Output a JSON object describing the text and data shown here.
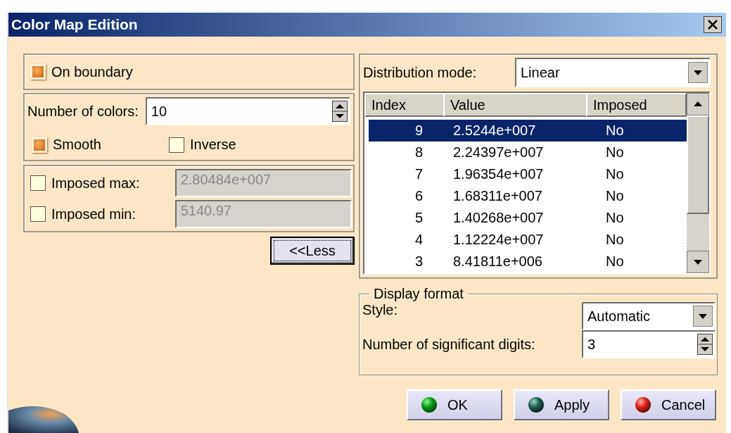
{
  "window": {
    "title": "Color Map Edition"
  },
  "on_boundary": {
    "label": "On boundary",
    "checked": true
  },
  "number_of_colors": {
    "label": "Number of colors:",
    "value": "10"
  },
  "options": [
    {
      "label": "Smooth",
      "checked": true
    },
    {
      "label": "Inverse",
      "checked": false
    }
  ],
  "imposed": [
    {
      "label": "Imposed max:",
      "checked": false,
      "value": "2.80484e+007",
      "disabled": true
    },
    {
      "label": "Imposed min:",
      "checked": false,
      "value": "5140.97",
      "disabled": true
    }
  ],
  "less_button": "<<Less",
  "distribution": {
    "label": "Distribution mode:",
    "value": "Linear"
  },
  "table": {
    "columns": [
      "Index",
      "Value",
      "Imposed"
    ],
    "rows": [
      {
        "cells": [
          "9",
          "2.5244e+007",
          "No"
        ],
        "selected": true
      },
      {
        "cells": [
          "8",
          "2.24397e+007",
          "No"
        ],
        "selected": false
      },
      {
        "cells": [
          "7",
          "1.96354e+007",
          "No"
        ],
        "selected": false
      },
      {
        "cells": [
          "6",
          "1.68311e+007",
          "No"
        ],
        "selected": false
      },
      {
        "cells": [
          "5",
          "1.40268e+007",
          "No"
        ],
        "selected": false
      },
      {
        "cells": [
          "4",
          "1.12224e+007",
          "No"
        ],
        "selected": false
      },
      {
        "cells": [
          "3",
          "8.41811e+006",
          "No"
        ],
        "selected": false
      }
    ]
  },
  "display_format": {
    "title": "Display format",
    "style": {
      "label": "Style:",
      "value": "Automatic"
    },
    "digits": {
      "label": "Number of significant digits:",
      "value": "3"
    }
  },
  "buttons": [
    {
      "label": "OK",
      "kind": "ok"
    },
    {
      "label": "Apply",
      "kind": "apply"
    },
    {
      "label": "Cancel",
      "kind": "cancel"
    }
  ]
}
